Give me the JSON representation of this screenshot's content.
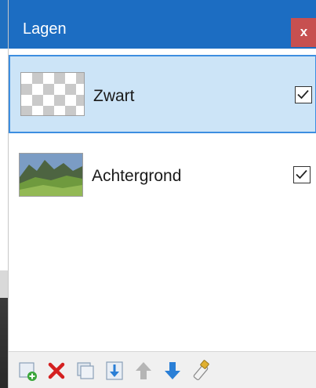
{
  "panel": {
    "title": "Lagen",
    "close_label": "x"
  },
  "layers": [
    {
      "name": "Zwart",
      "visible": true,
      "selected": true,
      "thumbnail": "transparent-checker"
    },
    {
      "name": "Achtergrond",
      "visible": true,
      "selected": false,
      "thumbnail": "mountain-landscape"
    }
  ],
  "toolbar": {
    "icons": [
      "add-layer-icon",
      "delete-layer-icon",
      "duplicate-layer-icon",
      "merge-layer-down-icon",
      "move-layer-up-icon",
      "move-layer-down-icon",
      "layer-properties-icon"
    ]
  },
  "colors": {
    "titlebar": "#1c6dc2",
    "close": "#c75050",
    "selection_fill": "#cce4f7",
    "selection_border": "#3d8ee0"
  }
}
